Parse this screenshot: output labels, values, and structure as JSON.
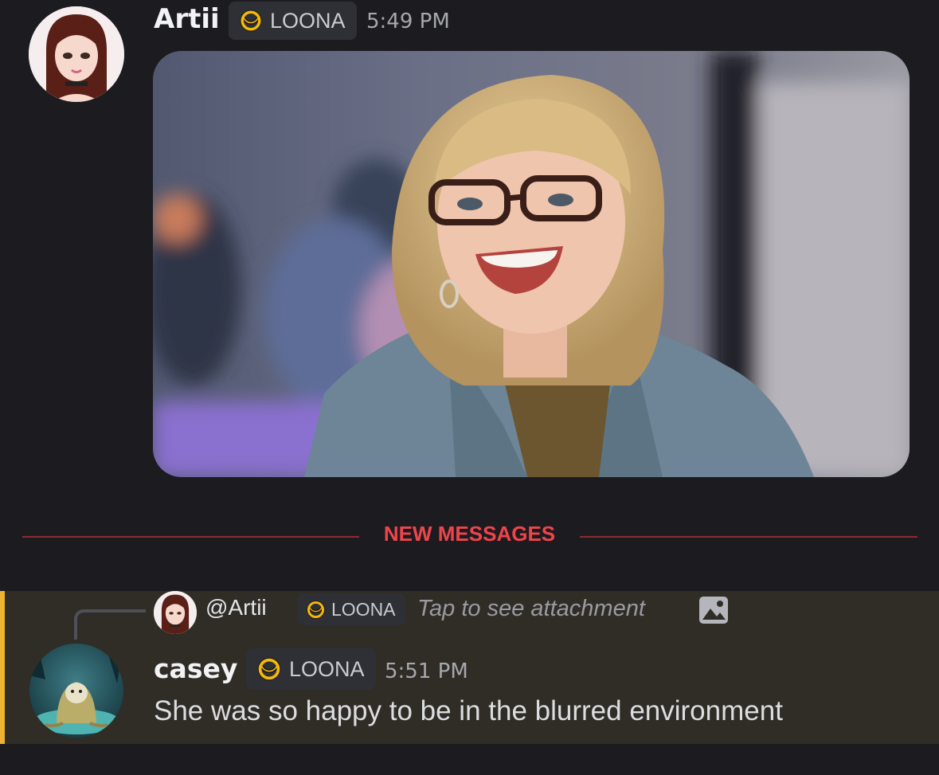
{
  "messages": [
    {
      "author": "Artii",
      "role": "LOONA",
      "time": "5:49 PM",
      "attachment_alt": "Photo of a smiling woman with blonde bangs and glasses wearing a denim jacket"
    }
  ],
  "divider": {
    "label": "NEW MESSAGES"
  },
  "reply": {
    "ref_author": "@Artii",
    "ref_role": "LOONA",
    "ref_preview": "Tap to see attachment",
    "ref_icon": "image-icon",
    "author": "casey",
    "role": "LOONA",
    "time": "5:51 PM",
    "text": "She was so happy to be in the blurred environment"
  },
  "colors": {
    "background": "#1c1c20",
    "highlight_bg": "#302d27",
    "highlight_accent": "#f0b232",
    "new_messages": "#f0444b",
    "role_moon": "#f5b80a"
  }
}
